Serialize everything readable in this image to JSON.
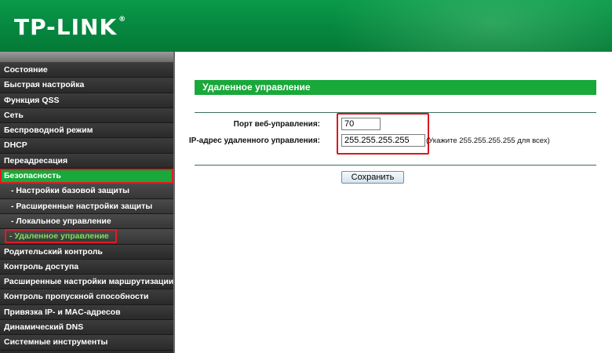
{
  "header": {
    "logo": "TP-LINK",
    "logo_mark": "®"
  },
  "sidebar": {
    "items": [
      {
        "label": "Состояние"
      },
      {
        "label": "Быстрая настройка"
      },
      {
        "label": "Функция QSS"
      },
      {
        "label": "Сеть"
      },
      {
        "label": "Беспроводной режим"
      },
      {
        "label": "DHCP"
      },
      {
        "label": "Переадресация"
      },
      {
        "label": "Безопасность"
      },
      {
        "label": "- Настройки базовой защиты"
      },
      {
        "label": "- Расширенные настройки защиты"
      },
      {
        "label": "- Локальное управление"
      },
      {
        "label": "- Удаленное управление"
      },
      {
        "label": "Родительский контроль"
      },
      {
        "label": "Контроль доступа"
      },
      {
        "label": "Расширенные настройки маршрутизации"
      },
      {
        "label": "Контроль пропускной способности"
      },
      {
        "label": "Привязка IP- и MAC-адресов"
      },
      {
        "label": "Динамический DNS"
      },
      {
        "label": "Системные инструменты"
      }
    ]
  },
  "main": {
    "section_title": "Удаленное управление",
    "port_label": "Порт веб-управления:",
    "port_value": "70",
    "ip_label": "IP-адрес удаленного управления:",
    "ip_value": "255.255.255.255",
    "ip_hint": "(Укажите 255.255.255.255 для всех)",
    "save_label": "Сохранить"
  },
  "colors": {
    "accent": "#19a83a",
    "highlight": "#d7191f",
    "sidebar_bg": "#2b2b2b"
  }
}
